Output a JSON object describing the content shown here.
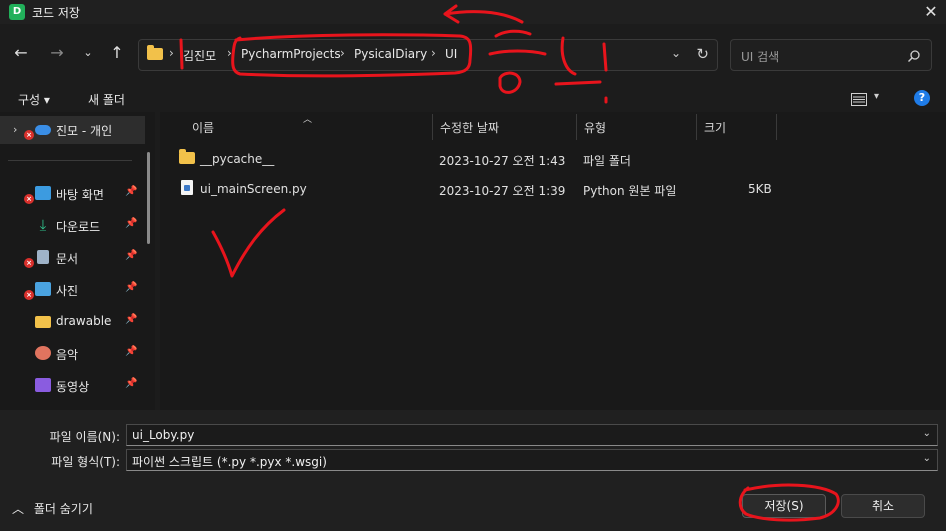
{
  "window": {
    "title": "코드 저장",
    "app_icon_letter": "D"
  },
  "nav": {
    "back_icon": "arrow-left-icon",
    "forward_icon": "arrow-right-icon",
    "recent_icon": "chevron-down-icon",
    "up_icon": "arrow-up-icon",
    "breadcrumbs": [
      "김진모",
      "PycharmProjects",
      "PysicalDiary",
      "UI"
    ],
    "search_placeholder": "UI 검색"
  },
  "toolbar": {
    "organize": "구성 ▾",
    "new_folder": "새 폴더",
    "help": "?"
  },
  "sidebar": {
    "items": [
      {
        "label": "진모 - 개인",
        "icon": "onedrive-cloud-icon",
        "color": "#3a8ee6"
      },
      {
        "label": "바탕 화면",
        "icon": "desktop-icon",
        "color": "#3c9be0"
      },
      {
        "label": "다운로드",
        "icon": "download-icon",
        "color": "#2fbf8a"
      },
      {
        "label": "문서",
        "icon": "document-icon",
        "color": "#9fb3c8"
      },
      {
        "label": "사진",
        "icon": "pictures-icon",
        "color": "#4aa3e0"
      },
      {
        "label": "drawable",
        "icon": "folder-icon",
        "color": "#f2c14a"
      },
      {
        "label": "음악",
        "icon": "music-icon",
        "color": "#e0745f"
      },
      {
        "label": "동영상",
        "icon": "video-icon",
        "color": "#8a5ce0"
      }
    ]
  },
  "files": {
    "columns": [
      "이름",
      "수정한 날짜",
      "유형",
      "크기"
    ],
    "rows": [
      {
        "name": "__pycache__",
        "date": "2023-10-27 오전 1:43",
        "type": "파일 폴더",
        "size": ""
      },
      {
        "name": "ui_mainScreen.py",
        "date": "2023-10-27 오전 1:39",
        "type": "Python 원본 파일",
        "size": "5KB"
      }
    ]
  },
  "form": {
    "filename_label": "파일 이름(N):",
    "filename_value": "ui_Loby.py",
    "filetype_label": "파일 형식(T):",
    "filetype_value": "파이썬 스크립트 (*.py *.pyx *.wsgi)"
  },
  "footer": {
    "hide_folders": "폴더 숨기기",
    "save": "저장(S)",
    "cancel": "취소"
  },
  "annotation_color": "#e8141c"
}
